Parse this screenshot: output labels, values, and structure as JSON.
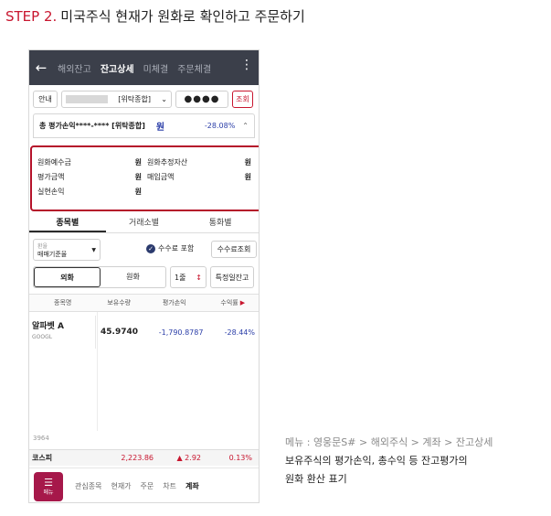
{
  "step": {
    "label": "STEP 2.",
    "title": "미국주식 현재가 원화로 확인하고 주문하기"
  },
  "appbar": {
    "back_icon": "arrow-left-icon",
    "tabs": [
      {
        "label": "해외잔고"
      },
      {
        "label": "잔고상세"
      },
      {
        "label": "미체결"
      },
      {
        "label": "주문체결"
      }
    ],
    "more_icon": "more-vertical-icon"
  },
  "toolbar": {
    "guide_label": "안내",
    "account_type": "[위탁종합]",
    "password_mask": "●●●●",
    "query_label": "조회"
  },
  "summary": {
    "label": "총 평가손익****-**** [위탁종합]",
    "unit": "원",
    "rate": "-28.08%"
  },
  "details": {
    "rows": [
      {
        "left_label": "원화예수금",
        "left_unit": "원",
        "right_label": "원화추정자산",
        "right_unit": "원"
      },
      {
        "left_label": "평가금액",
        "left_unit": "원",
        "right_label": "매입금액",
        "right_unit": "원"
      },
      {
        "left_label": "실현손익",
        "left_unit": "원",
        "right_label": "",
        "right_unit": ""
      }
    ]
  },
  "view_tabs": [
    {
      "label": "종목별"
    },
    {
      "label": "거래소별"
    },
    {
      "label": "통화별"
    }
  ],
  "filters": {
    "fx_caption": "환율",
    "fx_value": "매매기준율",
    "fee_label": "수수료 포함",
    "fee_query_label": "수수료조회"
  },
  "options": {
    "currency": [
      "외화",
      "원화"
    ],
    "period": "1줄",
    "date_balance_label": "특정일잔고"
  },
  "grid": {
    "headers": [
      "종목명",
      "보유수량",
      "평가손익",
      "수익률"
    ],
    "rows": [
      {
        "name": "알파벳 A",
        "ticker": "GOOGL",
        "qty": "45.9740",
        "pnl": "-1,790.8787",
        "rate": "-28.44%"
      }
    ],
    "partial_text": "3964"
  },
  "index_bar": {
    "name": "코스피",
    "value": "2,223.86",
    "change": "▲ 2.92",
    "pct": "0.13%"
  },
  "bottom_nav": {
    "menu_label": "메뉴",
    "items": [
      {
        "label": "관심종목"
      },
      {
        "label": "현재가"
      },
      {
        "label": "주문"
      },
      {
        "label": "차트"
      },
      {
        "label": "계좌"
      }
    ]
  },
  "caption": {
    "menu_path": "메뉴 : 영웅문S# > 해외주식 > 계좌 > 잔고상세",
    "desc_line1": "보유주식의 평가손익, 총수익 등 잔고평가의",
    "desc_line2": "원화 환산 표기"
  },
  "colors": {
    "accent_red": "#c8162f",
    "appbar_bg": "#3b3f4a",
    "menu_btn": "#a6184a",
    "blue_value": "#2b3ea8"
  }
}
